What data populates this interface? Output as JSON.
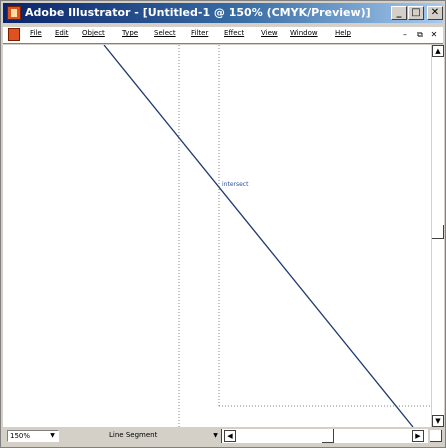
{
  "window": {
    "title": "Adobe Illustrator - [Untitled-1 @ 150% (CMYK/Preview)]",
    "buttons": {
      "minimize": "_",
      "maximize": "□",
      "close": "✕"
    }
  },
  "menubar": {
    "items": [
      {
        "label": "File"
      },
      {
        "label": "Edit"
      },
      {
        "label": "Object"
      },
      {
        "label": "Type"
      },
      {
        "label": "Select"
      },
      {
        "label": "Filter"
      },
      {
        "label": "Effect"
      },
      {
        "label": "View"
      },
      {
        "label": "Window"
      },
      {
        "label": "Help"
      }
    ],
    "mdi_buttons": {
      "minimize": "–",
      "restore": "⧉",
      "close": "✕"
    }
  },
  "canvas": {
    "smart_guide_label": "intersect",
    "line_color": "#1f3a6e",
    "guide_color": "#808080"
  },
  "statusbar": {
    "zoom": "150%",
    "status_text": "Line Segment"
  },
  "colors": {
    "title_start": "#0a246a",
    "title_end": "#a6caf0",
    "chrome": "#d4d0c8"
  }
}
